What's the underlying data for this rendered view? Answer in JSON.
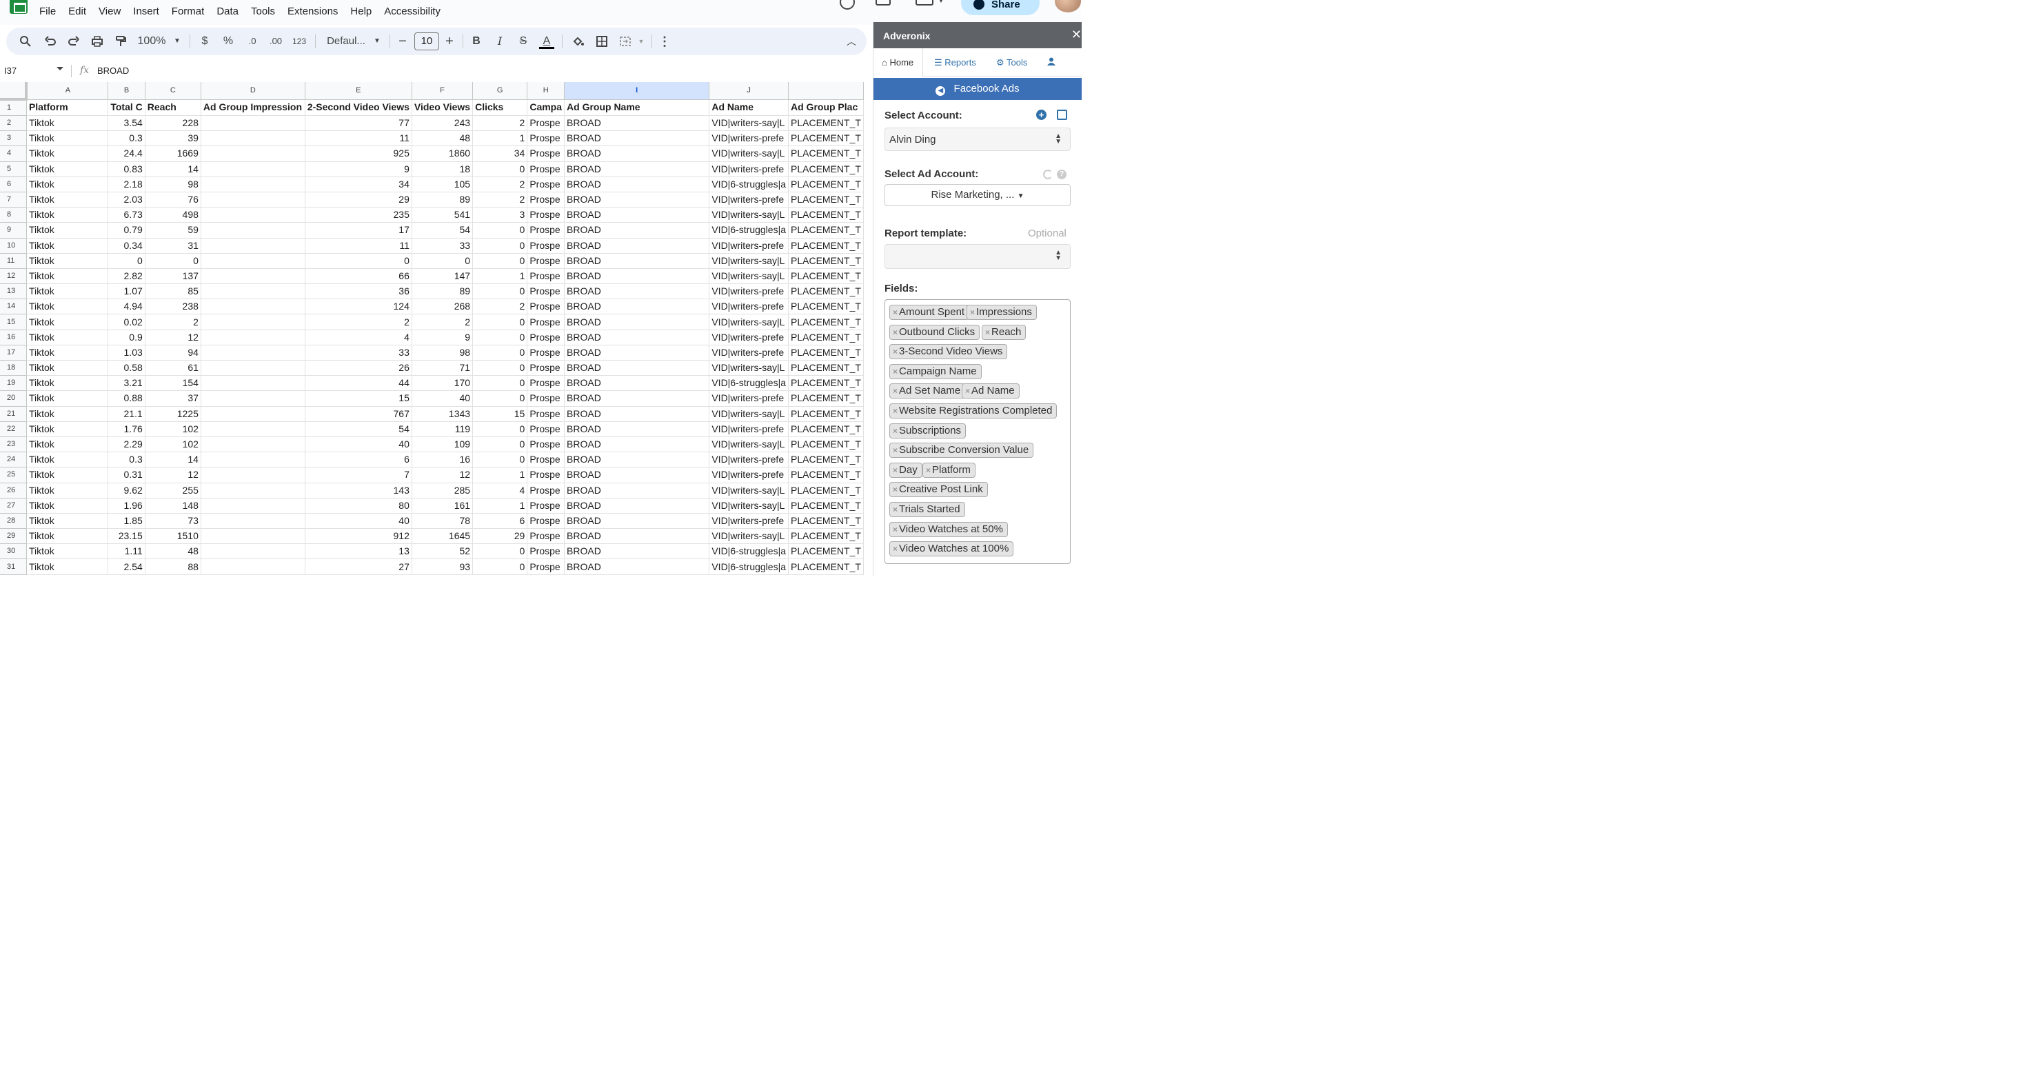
{
  "menu": [
    "File",
    "Edit",
    "View",
    "Insert",
    "Format",
    "Data",
    "Tools",
    "Extensions",
    "Help",
    "Accessibility"
  ],
  "share_label": "Share",
  "toolbar": {
    "zoom": "100%",
    "currency": "$",
    "percent": "%",
    "decrease_decimal": ".0",
    "increase_decimal": ".00",
    "number_format": "123",
    "font": "Defaul...",
    "font_size": "10",
    "bold": "B",
    "italic": "I",
    "strike": "S",
    "text_color": "A"
  },
  "formula_bar": {
    "cell_ref": "I37",
    "fx": "fx",
    "value": "BROAD"
  },
  "grid": {
    "columns": [
      "A",
      "B",
      "C",
      "D",
      "E",
      "F",
      "G",
      "H",
      "I",
      "J",
      ""
    ],
    "selected_column": "I",
    "header_row": [
      "Platform",
      "Total C",
      "Reach",
      "Ad Group Impression",
      "2-Second Video Views",
      "Video Views",
      "Clicks",
      "Campa",
      "Ad Group Name",
      "Ad Name",
      "Ad Group Plac"
    ],
    "rows": [
      [
        "Tiktok",
        "3.54",
        "228",
        "",
        "77",
        "243",
        "2",
        "Prospe",
        "BROAD",
        "VID|writers-say|L",
        "PLACEMENT_T"
      ],
      [
        "Tiktok",
        "0.3",
        "39",
        "",
        "11",
        "48",
        "1",
        "Prospe",
        "BROAD",
        "VID|writers-prefe",
        "PLACEMENT_T"
      ],
      [
        "Tiktok",
        "24.4",
        "1669",
        "",
        "925",
        "1860",
        "34",
        "Prospe",
        "BROAD",
        "VID|writers-say|L",
        "PLACEMENT_T"
      ],
      [
        "Tiktok",
        "0.83",
        "14",
        "",
        "9",
        "18",
        "0",
        "Prospe",
        "BROAD",
        "VID|writers-prefe",
        "PLACEMENT_T"
      ],
      [
        "Tiktok",
        "2.18",
        "98",
        "",
        "34",
        "105",
        "2",
        "Prospe",
        "BROAD",
        "VID|6-struggles|a",
        "PLACEMENT_T"
      ],
      [
        "Tiktok",
        "2.03",
        "76",
        "",
        "29",
        "89",
        "2",
        "Prospe",
        "BROAD",
        "VID|writers-prefe",
        "PLACEMENT_T"
      ],
      [
        "Tiktok",
        "6.73",
        "498",
        "",
        "235",
        "541",
        "3",
        "Prospe",
        "BROAD",
        "VID|writers-say|L",
        "PLACEMENT_T"
      ],
      [
        "Tiktok",
        "0.79",
        "59",
        "",
        "17",
        "54",
        "0",
        "Prospe",
        "BROAD",
        "VID|6-struggles|a",
        "PLACEMENT_T"
      ],
      [
        "Tiktok",
        "0.34",
        "31",
        "",
        "11",
        "33",
        "0",
        "Prospe",
        "BROAD",
        "VID|writers-prefe",
        "PLACEMENT_T"
      ],
      [
        "Tiktok",
        "0",
        "0",
        "",
        "0",
        "0",
        "0",
        "Prospe",
        "BROAD",
        "VID|writers-say|L",
        "PLACEMENT_T"
      ],
      [
        "Tiktok",
        "2.82",
        "137",
        "",
        "66",
        "147",
        "1",
        "Prospe",
        "BROAD",
        "VID|writers-say|L",
        "PLACEMENT_T"
      ],
      [
        "Tiktok",
        "1.07",
        "85",
        "",
        "36",
        "89",
        "0",
        "Prospe",
        "BROAD",
        "VID|writers-prefe",
        "PLACEMENT_T"
      ],
      [
        "Tiktok",
        "4.94",
        "238",
        "",
        "124",
        "268",
        "2",
        "Prospe",
        "BROAD",
        "VID|writers-prefe",
        "PLACEMENT_T"
      ],
      [
        "Tiktok",
        "0.02",
        "2",
        "",
        "2",
        "2",
        "0",
        "Prospe",
        "BROAD",
        "VID|writers-say|L",
        "PLACEMENT_T"
      ],
      [
        "Tiktok",
        "0.9",
        "12",
        "",
        "4",
        "9",
        "0",
        "Prospe",
        "BROAD",
        "VID|writers-prefe",
        "PLACEMENT_T"
      ],
      [
        "Tiktok",
        "1.03",
        "94",
        "",
        "33",
        "98",
        "0",
        "Prospe",
        "BROAD",
        "VID|writers-prefe",
        "PLACEMENT_T"
      ],
      [
        "Tiktok",
        "0.58",
        "61",
        "",
        "26",
        "71",
        "0",
        "Prospe",
        "BROAD",
        "VID|writers-say|L",
        "PLACEMENT_T"
      ],
      [
        "Tiktok",
        "3.21",
        "154",
        "",
        "44",
        "170",
        "0",
        "Prospe",
        "BROAD",
        "VID|6-struggles|a",
        "PLACEMENT_T"
      ],
      [
        "Tiktok",
        "0.88",
        "37",
        "",
        "15",
        "40",
        "0",
        "Prospe",
        "BROAD",
        "VID|writers-prefe",
        "PLACEMENT_T"
      ],
      [
        "Tiktok",
        "21.1",
        "1225",
        "",
        "767",
        "1343",
        "15",
        "Prospe",
        "BROAD",
        "VID|writers-say|L",
        "PLACEMENT_T"
      ],
      [
        "Tiktok",
        "1.76",
        "102",
        "",
        "54",
        "119",
        "0",
        "Prospe",
        "BROAD",
        "VID|writers-prefe",
        "PLACEMENT_T"
      ],
      [
        "Tiktok",
        "2.29",
        "102",
        "",
        "40",
        "109",
        "0",
        "Prospe",
        "BROAD",
        "VID|writers-say|L",
        "PLACEMENT_T"
      ],
      [
        "Tiktok",
        "0.3",
        "14",
        "",
        "6",
        "16",
        "0",
        "Prospe",
        "BROAD",
        "VID|writers-prefe",
        "PLACEMENT_T"
      ],
      [
        "Tiktok",
        "0.31",
        "12",
        "",
        "7",
        "12",
        "1",
        "Prospe",
        "BROAD",
        "VID|writers-prefe",
        "PLACEMENT_T"
      ],
      [
        "Tiktok",
        "9.62",
        "255",
        "",
        "143",
        "285",
        "4",
        "Prospe",
        "BROAD",
        "VID|writers-say|L",
        "PLACEMENT_T"
      ],
      [
        "Tiktok",
        "1.96",
        "148",
        "",
        "80",
        "161",
        "1",
        "Prospe",
        "BROAD",
        "VID|writers-say|L",
        "PLACEMENT_T"
      ],
      [
        "Tiktok",
        "1.85",
        "73",
        "",
        "40",
        "78",
        "6",
        "Prospe",
        "BROAD",
        "VID|writers-prefe",
        "PLACEMENT_T"
      ],
      [
        "Tiktok",
        "23.15",
        "1510",
        "",
        "912",
        "1645",
        "29",
        "Prospe",
        "BROAD",
        "VID|writers-say|L",
        "PLACEMENT_T"
      ],
      [
        "Tiktok",
        "1.11",
        "48",
        "",
        "13",
        "52",
        "0",
        "Prospe",
        "BROAD",
        "VID|6-struggles|a",
        "PLACEMENT_T"
      ],
      [
        "Tiktok",
        "2.54",
        "88",
        "",
        "27",
        "93",
        "0",
        "Prospe",
        "BROAD",
        "VID|6-struggles|a",
        "PLACEMENT_T"
      ]
    ]
  },
  "sidebar": {
    "title": "Adveronix",
    "nav": {
      "home": "Home",
      "reports": "Reports",
      "tools": "Tools"
    },
    "banner": "Facebook Ads",
    "select_account_label": "Select Account:",
    "account_value": "Alvin Ding",
    "select_ad_account_label": "Select Ad Account:",
    "ad_account_value": "Rise Marketing, ...",
    "report_template_label": "Report template:",
    "report_template_optional": "Optional",
    "report_template_value": "",
    "fields_label": "Fields:",
    "fields": [
      "Amount Spent",
      "Impressions",
      "Outbound Clicks",
      "Reach",
      "3-Second Video Views",
      "Campaign Name",
      "Ad Set Name",
      "Ad Name",
      "Website Registrations Completed",
      "Subscriptions",
      "Subscribe Conversion Value",
      "Day",
      "Platform",
      "Creative Post Link",
      "Trials Started",
      "Video Watches at 50%",
      "Video Watches at 100%"
    ]
  },
  "colors": {
    "sheets_green": "#1e8e3e",
    "toolbar_bg": "#edf2fa",
    "selected_header": "#d3e3fd",
    "sidebar_banner": "#3b6fb6",
    "sidebar_titlebar": "#5f6368",
    "share_button": "#c2e7ff"
  }
}
